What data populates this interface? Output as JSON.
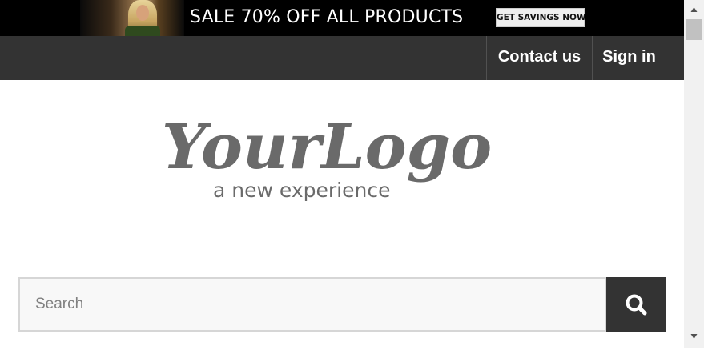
{
  "promo": {
    "headline": "SALE 70% OFF ALL PRODUCTS",
    "button_label": "GET SAVINGS NOW"
  },
  "nav": {
    "contact_label": "Contact us",
    "signin_label": "Sign in"
  },
  "logo": {
    "wordmark": "YourLogo",
    "tagline": "a new experience"
  },
  "search": {
    "placeholder": "Search",
    "value": ""
  },
  "icons": {
    "search_button": "search-icon",
    "scroll_up": "chevron-up-icon",
    "scroll_down": "chevron-down-icon"
  },
  "colors": {
    "navbar": "#333333",
    "promo_bg": "#000000",
    "logo_gray": "#6a6a6a",
    "search_button": "#333333"
  }
}
